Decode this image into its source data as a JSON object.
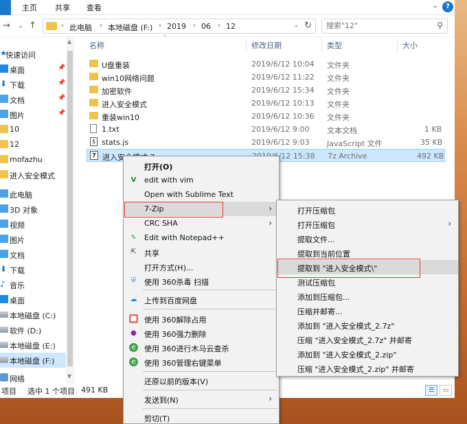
{
  "ribbon": {
    "tabs": [
      "主页",
      "共享",
      "查看"
    ]
  },
  "address": {
    "crumbs": [
      "此电脑",
      "本地磁盘 (F:)",
      "2019",
      "06",
      "12"
    ]
  },
  "search": {
    "placeholder": "搜索\"12\""
  },
  "sidebar": {
    "items": [
      {
        "label": "快速访问"
      },
      {
        "label": "桌面"
      },
      {
        "label": "下载"
      },
      {
        "label": "文档"
      },
      {
        "label": "图片"
      },
      {
        "label": "10"
      },
      {
        "label": "12"
      },
      {
        "label": "mofazhu"
      },
      {
        "label": "进入安全模式"
      },
      {
        "label": "此电脑"
      },
      {
        "label": "3D 对象"
      },
      {
        "label": "视频"
      },
      {
        "label": "图片"
      },
      {
        "label": "文档"
      },
      {
        "label": "下载"
      },
      {
        "label": "音乐"
      },
      {
        "label": "桌面"
      },
      {
        "label": "本地磁盘 (C:)"
      },
      {
        "label": "软件 (D:)"
      },
      {
        "label": "本地磁盘 (E:)"
      },
      {
        "label": "本地磁盘 (F:)"
      },
      {
        "label": "网络"
      }
    ]
  },
  "columns": {
    "name": "名称",
    "date": "修改日期",
    "type": "类型",
    "size": "大小"
  },
  "files": [
    {
      "name": "U盘重装",
      "date": "2019/6/12 10:04",
      "type": "文件夹",
      "size": ""
    },
    {
      "name": "win10网络问题",
      "date": "2019/6/12 11:22",
      "type": "文件夹",
      "size": ""
    },
    {
      "name": "加密软件",
      "date": "2019/6/12 15:34",
      "type": "文件夹",
      "size": ""
    },
    {
      "name": "进入安全模式",
      "date": "2019/6/12 10:13",
      "type": "文件夹",
      "size": ""
    },
    {
      "name": "重装win10",
      "date": "2019/6/12 10:36",
      "type": "文件夹",
      "size": ""
    },
    {
      "name": "1.txt",
      "date": "2019/6/12 9:00",
      "type": "文本文档",
      "size": "1 KB"
    },
    {
      "name": "stats.js",
      "date": "2019/6/12 9:03",
      "type": "JavaScript 文件",
      "size": "35 KB"
    },
    {
      "name": "进入安全模式.7z",
      "date": "2019/6/12 15:38",
      "type": "7z Archive",
      "size": "492 KB"
    }
  ],
  "status": {
    "count": "项目",
    "selected": "选中 1 个项目",
    "size": "491 KB"
  },
  "context_menu": {
    "items": [
      "打开(O)",
      "edit with vim",
      "Open with Sublime Text",
      "7-Zip",
      "CRC SHA",
      "Edit with Notepad++",
      "共享",
      "打开方式(H)...",
      "使用 360杀毒 扫描",
      "上传到百度网盘",
      "使用 360解除占用",
      "使用 360强力删除",
      "使用 360进行木马云查杀",
      "使用 360管理右键菜单",
      "还原以前的版本(V)",
      "发送到(N)",
      "剪切(T)"
    ]
  },
  "submenu": {
    "items": [
      "打开压缩包",
      "打开压缩包",
      "提取文件...",
      "提取到当前位置",
      "提取到 \"进入安全模式\\\"",
      "测试压缩包",
      "添加到压缩包...",
      "压缩并邮寄...",
      "添加到 \"进入安全模式_2.7z\"",
      "压缩 \"进入安全模式_2.7z\" 并邮寄",
      "添加到 \"进入安全模式_2.zip\"",
      "压缩 \"进入安全模式_2.zip\" 并邮寄"
    ]
  },
  "colors": {
    "accent": "#1979ca",
    "selection": "#cce8ff",
    "highlight_box": "#e53935",
    "folder": "#f0c44c"
  }
}
